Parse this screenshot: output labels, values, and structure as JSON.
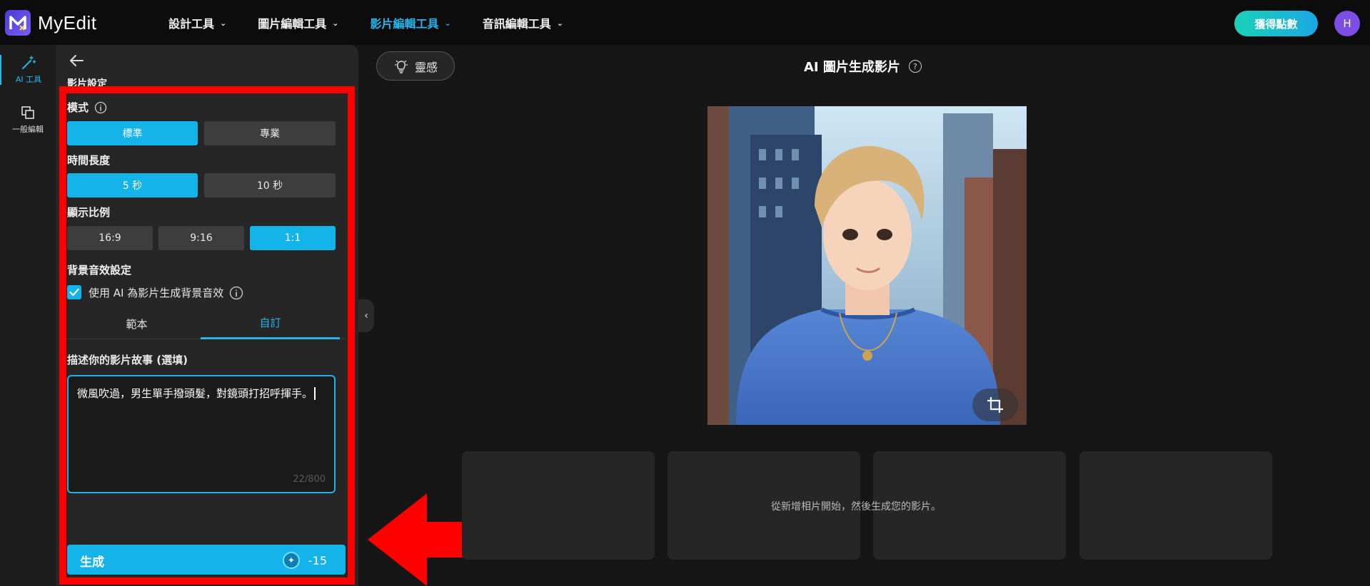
{
  "app": {
    "logo_text": "MyEdit"
  },
  "nav": {
    "items": [
      {
        "label": "設計工具",
        "active": false
      },
      {
        "label": "圖片編輯工具",
        "active": false
      },
      {
        "label": "影片編輯工具",
        "active": true
      },
      {
        "label": "音訊編輯工具",
        "active": false
      }
    ],
    "points_button": "獲得點數",
    "avatar_initial": "H"
  },
  "rail": {
    "ai_tools": "AI 工具",
    "general_edit": "一般編輯"
  },
  "panel": {
    "title": "影片設定",
    "mode": {
      "label": "模式",
      "options": [
        "標準",
        "專業"
      ],
      "selected": "標準"
    },
    "duration": {
      "label": "時間長度",
      "options": [
        "5 秒",
        "10 秒"
      ],
      "selected": "5 秒"
    },
    "ratio": {
      "label": "顯示比例",
      "options": [
        "16:9",
        "9:16",
        "1:1"
      ],
      "selected": "1:1"
    },
    "bg_audio": {
      "label": "背景音效設定",
      "checkbox_label": "使用 AI 為影片生成背景音效",
      "checked": true
    },
    "tabs": {
      "items": [
        "範本",
        "自訂"
      ],
      "selected": "自訂"
    },
    "story": {
      "label": "描述你的影片故事 (選填)",
      "value": "微風吹過，男生單手撥頭髮，對鏡頭打招呼揮手。",
      "count": "22/800"
    },
    "generate": {
      "label": "生成",
      "cost": "-15"
    }
  },
  "main": {
    "idea_button": "靈感",
    "title": "AI 圖片生成影片",
    "empty_hint": "從新增相片開始，然後生成您的影片。"
  },
  "colors": {
    "accent": "#14b3ea",
    "highlight_frame": "#ff0000",
    "background": "#161616",
    "panel": "#262626"
  }
}
